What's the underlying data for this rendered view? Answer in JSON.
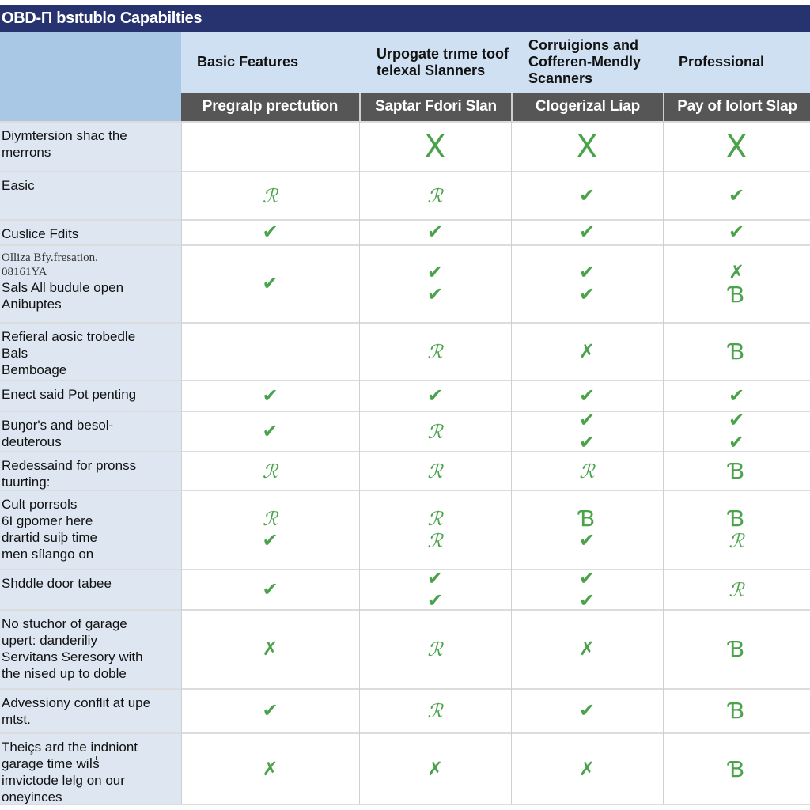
{
  "title": "OBD-П bsıtublo Capabilties",
  "colors": {
    "title_bg": "#27336e",
    "mark_green": "#4aa34a",
    "subheader_bg": "#565656",
    "header_bg": "#cfe0f2",
    "label_bg": "#dde6f1"
  },
  "mark_glyphs": {
    "check": "✔",
    "cross": "✗",
    "big-cross": "X",
    "scribble-check": "ℛ",
    "loop": "Ɓ",
    "": ""
  },
  "columns": [
    {
      "header": "Basic Features",
      "subheader": "Pregralp prectution"
    },
    {
      "header": "Urpogate trıme toof telexal Slanners",
      "subheader": "Saptar Fdori Slan"
    },
    {
      "header": "Corruigions and Cofferen-Mendly Scanners",
      "subheader": "Clogerizal Liap"
    },
    {
      "header": "Professional",
      "subheader": "Pay of lolort Slap"
    }
  ],
  "rows": [
    {
      "label": [
        "Diymtersion shac the",
        "merrons"
      ],
      "serif": [],
      "cells": [
        [],
        [
          "big-cross"
        ],
        [
          "big-cross"
        ],
        [
          "big-cross"
        ]
      ]
    },
    {
      "label": [
        "Easic"
      ],
      "serif": [],
      "cells": [
        [
          "scribble-check"
        ],
        [
          "scribble-check"
        ],
        [
          "check"
        ],
        [
          "check"
        ]
      ]
    },
    {
      "label": [
        "Cuslice Fdits"
      ],
      "serif": [],
      "cells": [
        [
          "check"
        ],
        [
          "check"
        ],
        [
          "check"
        ],
        [
          "check"
        ]
      ]
    },
    {
      "label": [
        "Sals All budule open",
        "Anibuptes"
      ],
      "serif": [
        "Olliza Bfy.fresation.",
        "08161YA"
      ],
      "cells": [
        [
          "check"
        ],
        [
          "check",
          "check"
        ],
        [
          "check",
          "check"
        ],
        [
          "cross",
          "loop"
        ]
      ]
    },
    {
      "label": [
        "Refieral aosic trobedle",
        "Bals",
        "Bemboage"
      ],
      "serif": [],
      "cells": [
        [],
        [
          "scribble-check"
        ],
        [
          "cross"
        ],
        [
          "loop"
        ]
      ]
    },
    {
      "label": [
        "Enect said Pot penting"
      ],
      "serif": [],
      "cells": [
        [
          "check"
        ],
        [
          "check"
        ],
        [
          "check"
        ],
        [
          "check"
        ]
      ]
    },
    {
      "label": [
        "Buŋor's and besol-",
        "deuterous"
      ],
      "serif": [],
      "cells": [
        [
          "check"
        ],
        [
          "scribble-check"
        ],
        [
          "check",
          "check"
        ],
        [
          "check",
          "check"
        ]
      ]
    },
    {
      "label": [
        "Redessaind for pronss",
        "tuurting:"
      ],
      "serif": [],
      "cells": [
        [
          "scribble-check"
        ],
        [
          "scribble-check"
        ],
        [
          "scribble-check"
        ],
        [
          "loop"
        ]
      ]
    },
    {
      "label": [
        "Cult porrsols",
        "6I gpomer here",
        "drartid suiþ time",
        "men sílango on"
      ],
      "serif": [],
      "cells": [
        [
          "scribble-check",
          "check"
        ],
        [
          "scribble-check",
          "scribble-check"
        ],
        [
          "loop",
          "check"
        ],
        [
          "loop",
          "scribble-check"
        ]
      ]
    },
    {
      "label": [
        "Shddle door tabee"
      ],
      "serif": [],
      "cells": [
        [
          "check"
        ],
        [
          "check",
          "check"
        ],
        [
          "check",
          "check"
        ],
        [
          "scribble-check"
        ]
      ]
    },
    {
      "label": [
        "No stuchor of garage",
        "upert: danderiliy",
        "Servitans Seresory with",
        "the nised up to doble"
      ],
      "serif": [],
      "cells": [
        [
          "cross"
        ],
        [
          "scribble-check"
        ],
        [
          "cross"
        ],
        [
          "loop"
        ]
      ]
    },
    {
      "label": [
        "Advessiony conflit at upe",
        "mtst."
      ],
      "serif": [],
      "cells": [
        [
          "check"
        ],
        [
          "scribble-check"
        ],
        [
          "check"
        ],
        [
          "loop"
        ]
      ]
    },
    {
      "label": [
        "Theiçs ard the indniont",
        "garage time wilٰs",
        "imvictode lelg on our",
        "oneyinces"
      ],
      "serif": [],
      "cells": [
        [
          "cross"
        ],
        [
          "cross"
        ],
        [
          "cross"
        ],
        [
          "loop"
        ]
      ]
    }
  ]
}
